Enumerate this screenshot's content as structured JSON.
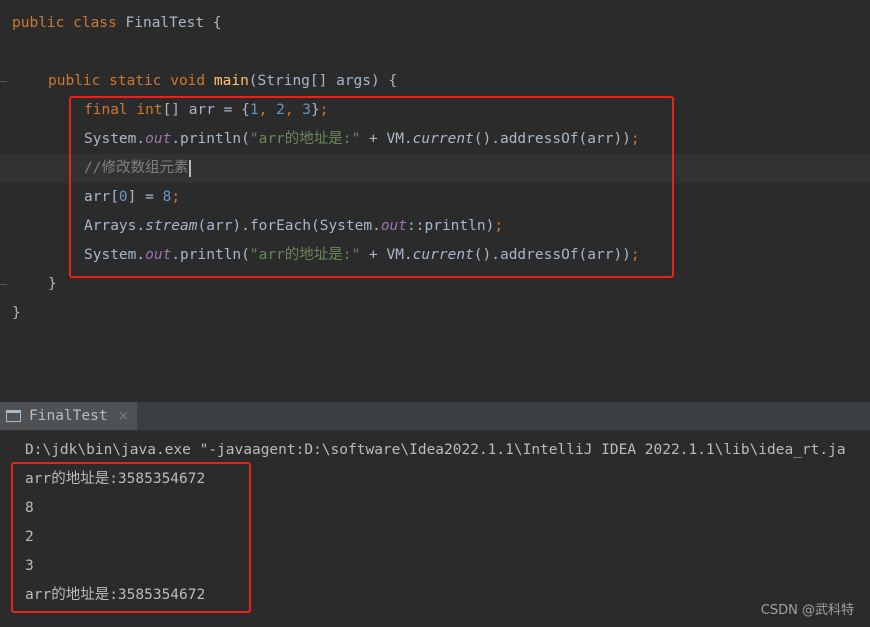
{
  "editor": {
    "lines": {
      "l1": {
        "kw": "public class ",
        "cls": "FinalTest {"
      },
      "l3": {
        "kw": "public static void ",
        "fn": "main",
        "rest": "(String[] args) {"
      },
      "l4": {
        "kw": "final int",
        "a": "[] arr = {",
        "n1": "1",
        "c1": ", ",
        "n2": "2",
        "c2": ", ",
        "n3": "3",
        "b": "}",
        "semi": ";"
      },
      "l5": {
        "a": "System.",
        "out": "out",
        "b": ".println(",
        "str": "\"arr的地址是:\"",
        "c": " + VM.",
        "cur": "current",
        "d": "().addressOf(arr))",
        "semi": ";"
      },
      "l6": {
        "cmt": "//修改数组元素"
      },
      "l7": {
        "a": "arr[",
        "n0": "0",
        "b": "] = ",
        "n8": "8",
        "semi": ";"
      },
      "l8": {
        "a": "Arrays.",
        "stream": "stream",
        "b": "(arr).forEach(System.",
        "out": "out",
        "c": "::println)",
        "semi": ";"
      },
      "l9": {
        "a": "System.",
        "out": "out",
        "b": ".println(",
        "str": "\"arr的地址是:\"",
        "c": " + VM.",
        "cur": "current",
        "d": "().addressOf(arr))",
        "semi": ";"
      },
      "l10": {
        "text": "}"
      },
      "l11": {
        "text": "}"
      }
    }
  },
  "run_panel": {
    "tab_label": "FinalTest",
    "tab_close": "×",
    "command": "D:\\jdk\\bin\\java.exe \"-javaagent:D:\\software\\Idea2022.1.1\\IntelliJ IDEA 2022.1.1\\lib\\idea_rt.ja",
    "output": [
      "arr的地址是:3585354672",
      "8",
      "2",
      "3",
      "arr的地址是:3585354672"
    ]
  },
  "watermark": "CSDN @武科特",
  "colors": {
    "background": "#2b2b2b",
    "keyword": "#cc7832",
    "number": "#6897bb",
    "string": "#6a8759",
    "method": "#ffc66d",
    "field": "#9876aa",
    "comment": "#808080",
    "highlight_box": "#e8231c"
  }
}
